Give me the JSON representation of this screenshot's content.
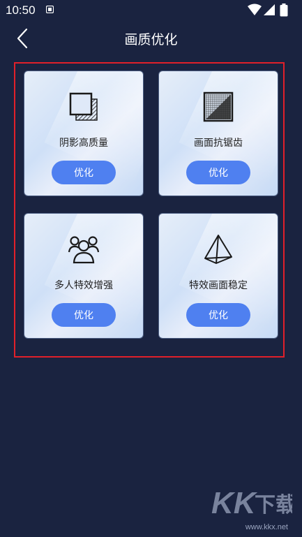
{
  "status_bar": {
    "time": "10:50"
  },
  "header": {
    "title": "画质优化"
  },
  "cards": [
    {
      "label": "阴影高质量",
      "button": "优化",
      "icon": "shadow-layer-icon"
    },
    {
      "label": "画面抗锯齿",
      "button": "优化",
      "icon": "anti-alias-grid-icon"
    },
    {
      "label": "多人特效增强",
      "button": "优化",
      "icon": "multi-user-icon"
    },
    {
      "label": "特效画面稳定",
      "button": "优化",
      "icon": "pyramid-icon"
    }
  ],
  "watermark": {
    "text": "KK下载",
    "url": "www.kkx.net"
  },
  "colors": {
    "background": "#1a2340",
    "accent": "#4f80f0",
    "frame": "#e0202a"
  }
}
